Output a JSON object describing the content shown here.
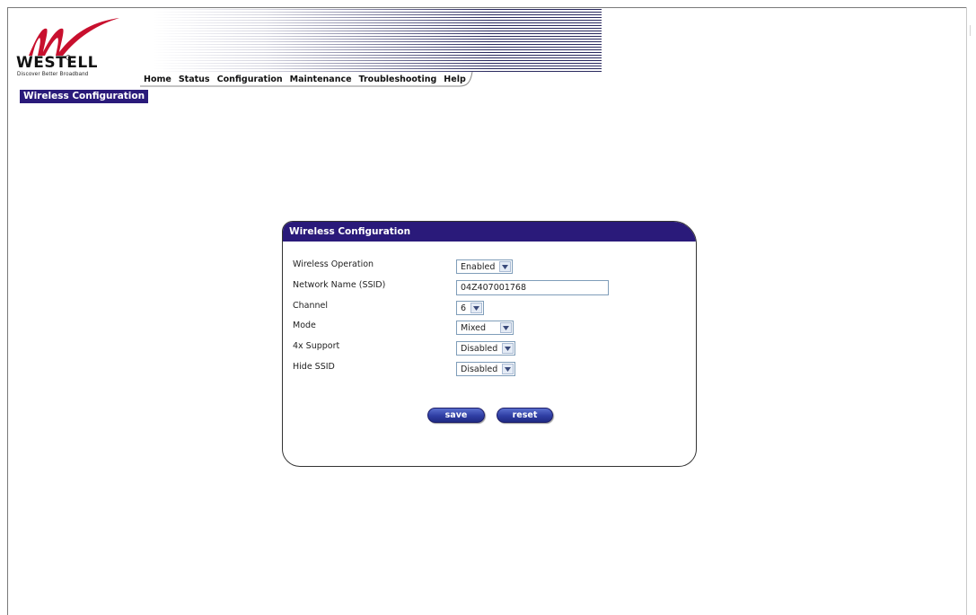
{
  "brand": {
    "name": "WESTELL",
    "tagline": "Discover  Better  Broadband",
    "colors": {
      "accent": "#2a1a7a",
      "logo_red": "#c8102e"
    }
  },
  "nav": {
    "items": [
      {
        "label": "Home",
        "icon": ""
      },
      {
        "label": "Status"
      },
      {
        "label": "Configuration"
      },
      {
        "label": "Maintenance"
      },
      {
        "label": "Troubleshooting"
      },
      {
        "label": "Help"
      }
    ]
  },
  "breadcrumb": "Wireless Configuration",
  "panel": {
    "title": "Wireless Configuration",
    "fields": {
      "wireless_operation": {
        "label": "Wireless Operation",
        "value": "Enabled"
      },
      "ssid": {
        "label": "Network Name (SSID)",
        "value": "04Z407001768"
      },
      "channel": {
        "label": "Channel",
        "value": "6"
      },
      "mode": {
        "label": "Mode",
        "value": "Mixed"
      },
      "four_x": {
        "label": "4x Support",
        "value": "Disabled"
      },
      "hide_ssid": {
        "label": "Hide SSID",
        "value": "Disabled"
      }
    },
    "buttons": {
      "save": "save",
      "reset": "reset"
    },
    "icons": {
      "dropdown": "chevron-down-icon"
    }
  }
}
